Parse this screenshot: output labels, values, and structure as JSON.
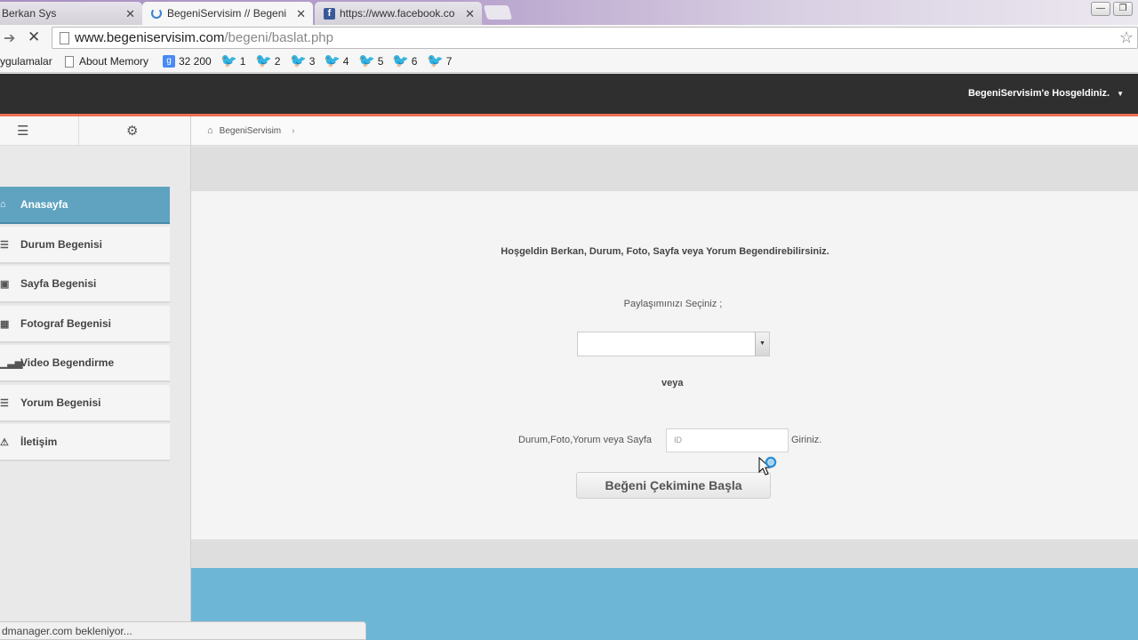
{
  "browser": {
    "tabs": [
      {
        "title": "Berkan Sys",
        "active": false
      },
      {
        "title": "BegeniServisim // Begeni",
        "active": true
      },
      {
        "title": "https://www.facebook.co",
        "active": false
      }
    ],
    "url_domain": "www.begeniservisim.com",
    "url_path": "/begeni/baslat.php",
    "bookmarks": [
      {
        "label": "ygulamalar",
        "icon": "apps"
      },
      {
        "label": "About Memory",
        "icon": "page-icon"
      },
      {
        "label": "32 200",
        "icon": "google-plus-icon"
      },
      {
        "label": "1",
        "icon": "twitter-icon"
      },
      {
        "label": "2",
        "icon": "twitter-icon"
      },
      {
        "label": "3",
        "icon": "twitter-icon"
      },
      {
        "label": "4",
        "icon": "twitter-icon"
      },
      {
        "label": "5",
        "icon": "twitter-icon"
      },
      {
        "label": "6",
        "icon": "twitter-icon"
      },
      {
        "label": "7",
        "icon": "twitter-icon"
      }
    ],
    "status": "dmanager.com bekleniyor..."
  },
  "header": {
    "welcome": "BegeniServisim'e Hosgeldiniz."
  },
  "breadcrumb": {
    "item": "BegeniServisim"
  },
  "sidebar": {
    "items": [
      {
        "label": "Anasayfa",
        "icon": "home-icon",
        "active": true
      },
      {
        "label": "Durum Begenisi",
        "icon": "list-icon",
        "active": false
      },
      {
        "label": "Sayfa Begenisi",
        "icon": "image-icon",
        "active": false
      },
      {
        "label": "Fotograf Begenisi",
        "icon": "grid-icon",
        "active": false
      },
      {
        "label": "Video Begendirme",
        "icon": "signal-icon",
        "active": false
      },
      {
        "label": "Yorum Begenisi",
        "icon": "list-icon",
        "active": false
      },
      {
        "label": "İletişim",
        "icon": "warning-icon",
        "active": false
      }
    ]
  },
  "main": {
    "intro": "Hoşgeldin Berkan, Durum, Foto, Sayfa veya Yorum Begendirebilirsiniz.",
    "choose_label": "Paylaşımınızı Seçiniz ;",
    "select_value": "",
    "or_label": "veya",
    "id_label": "Durum,Foto,Yorum veya Sayfa",
    "id_placeholder": "ID",
    "enter_label": "Giriniz.",
    "start_button": "Beğeni Çekimine Başla"
  },
  "colors": {
    "header_bg": "#2f2f2f",
    "accent_line": "#f07055",
    "active_menu": "#5fa3c0",
    "footer_blue": "#6db6d6"
  }
}
